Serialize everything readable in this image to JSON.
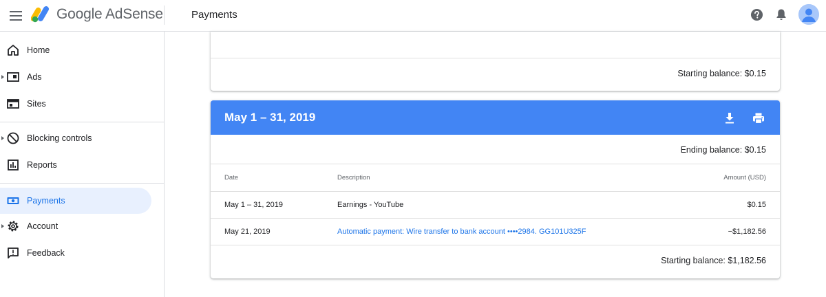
{
  "app": {
    "brand": "Google AdSense",
    "page_title": "Payments"
  },
  "sidebar": {
    "items": [
      {
        "label": "Home",
        "icon": "home-icon",
        "expandable": false
      },
      {
        "label": "Ads",
        "icon": "ads-icon",
        "expandable": true
      },
      {
        "label": "Sites",
        "icon": "sites-icon",
        "expandable": false
      },
      {
        "label": "Blocking controls",
        "icon": "block-icon",
        "expandable": true
      },
      {
        "label": "Reports",
        "icon": "reports-icon",
        "expandable": false
      },
      {
        "label": "Payments",
        "icon": "payments-icon",
        "expandable": false,
        "active": true
      },
      {
        "label": "Account",
        "icon": "gear-icon",
        "expandable": true
      },
      {
        "label": "Feedback",
        "icon": "feedback-icon",
        "expandable": false
      }
    ]
  },
  "previous_period": {
    "starting_balance": "Starting balance: $0.15"
  },
  "period": {
    "title": "May 1 – 31, 2019",
    "ending_balance": "Ending balance: $0.15",
    "columns": {
      "date": "Date",
      "description": "Description",
      "amount": "Amount (USD)"
    },
    "rows": [
      {
        "date": "May 1 – 31, 2019",
        "description": "Earnings - YouTube",
        "amount": "$0.15",
        "is_link": false
      },
      {
        "date": "May 21, 2019",
        "description": "Automatic payment: Wire transfer to bank account ••••2984. GG101U325F",
        "amount": "−$1,182.56",
        "is_link": true
      }
    ],
    "starting_balance": "Starting balance: $1,182.56"
  },
  "colors": {
    "accent": "#1a73e8",
    "header_blue": "#4285f4",
    "active_nav_bg": "#e8f0fe"
  }
}
